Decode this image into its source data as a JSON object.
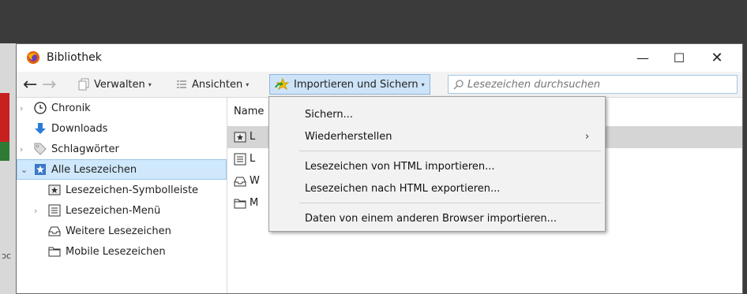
{
  "window": {
    "title": "Bibliothek"
  },
  "window_controls": {
    "minimize": "—",
    "maximize": "☐",
    "close": "✕"
  },
  "toolbar": {
    "back": "←",
    "forward": "→",
    "manage_label": "Verwalten",
    "views_label": "Ansichten",
    "import_label": "Importieren und Sichern",
    "caret": "▾"
  },
  "search": {
    "placeholder": "Lesezeichen durchsuchen"
  },
  "sidebar": {
    "items": [
      {
        "label": "Chronik",
        "icon": "clock-icon"
      },
      {
        "label": "Downloads",
        "icon": "download-arrow-icon"
      },
      {
        "label": "Schlagwörter",
        "icon": "tag-icon"
      },
      {
        "label": "Alle Lesezeichen",
        "icon": "bookmarks-star-icon"
      },
      {
        "label": "Lesezeichen-Symbolleiste",
        "icon": "star-box-icon"
      },
      {
        "label": "Lesezeichen-Menü",
        "icon": "list-icon"
      },
      {
        "label": "Weitere Lesezeichen",
        "icon": "tray-icon"
      },
      {
        "label": "Mobile Lesezeichen",
        "icon": "folder-icon"
      }
    ]
  },
  "content": {
    "column_name": "Name",
    "rows": [
      "L",
      "L",
      "W",
      "M"
    ]
  },
  "menu": {
    "items": [
      {
        "label": "Sichern...",
        "submenu": ""
      },
      {
        "label": "Wiederherstellen",
        "submenu": "›"
      },
      {
        "label": "Lesezeichen von HTML importieren...",
        "submenu": ""
      },
      {
        "label": "Lesezeichen nach HTML exportieren...",
        "submenu": ""
      },
      {
        "label": "Daten von einem anderen Browser importieren...",
        "submenu": ""
      }
    ]
  },
  "background": {
    "side_text": "ɔc"
  },
  "colors": {
    "selection": "#cfe8fb",
    "import_button": "#cde3f7",
    "highlight_row": "#d5d5d5"
  }
}
